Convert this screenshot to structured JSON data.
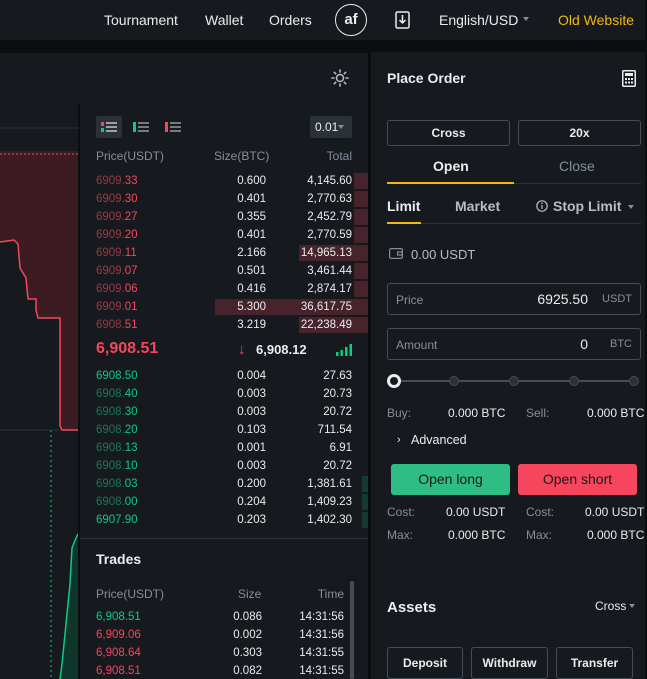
{
  "nav": {
    "links": [
      "Tournament",
      "Wallet",
      "Orders"
    ],
    "avatar": "af",
    "language": "English/USD",
    "old_site": "Old Website"
  },
  "colors": {
    "up": "#0ecb81",
    "down": "#f6465d",
    "accent": "#f0b90b",
    "bg": "#161a1e"
  },
  "orderbook": {
    "precision": "0.01",
    "headers": {
      "price": "Price(USDT)",
      "size": "Size(BTC)",
      "total": "Total"
    },
    "asks": [
      {
        "hi": "6909.",
        "lo": "33",
        "size": "0.600",
        "total": "4,145.60",
        "depth": 0.05
      },
      {
        "hi": "6909.",
        "lo": "30",
        "size": "0.401",
        "total": "2,770.63",
        "depth": 0.05
      },
      {
        "hi": "6909.",
        "lo": "27",
        "size": "0.355",
        "total": "2,452.79",
        "depth": 0.05
      },
      {
        "hi": "6909.",
        "lo": "20",
        "size": "0.401",
        "total": "2,770.59",
        "depth": 0.05
      },
      {
        "hi": "6909.",
        "lo": "11",
        "size": "2.166",
        "total": "14,965.13",
        "depth": 0.24
      },
      {
        "hi": "6909.",
        "lo": "07",
        "size": "0.501",
        "total": "3,461.44",
        "depth": 0.05
      },
      {
        "hi": "6909.",
        "lo": "06",
        "size": "0.416",
        "total": "2,874.17",
        "depth": 0.05
      },
      {
        "hi": "6909.",
        "lo": "01",
        "size": "5.300",
        "total": "36,617.75",
        "depth": 0.53
      },
      {
        "hi": "6908.",
        "lo": "51",
        "size": "3.219",
        "total": "22,238.49",
        "depth": 0.24
      }
    ],
    "mid": {
      "price": "6,908.51",
      "arrow": "↓",
      "mark": "6,908.12"
    },
    "bids": [
      {
        "hi": "6908.",
        "lo": "50",
        "size": "0.004",
        "total": "27.63",
        "hl": true,
        "depth": 0.0
      },
      {
        "hi": "6908.",
        "lo": "40",
        "size": "0.003",
        "total": "20.73",
        "hl": false,
        "depth": 0.0
      },
      {
        "hi": "6908.",
        "lo": "30",
        "size": "0.003",
        "total": "20.72",
        "hl": false,
        "depth": 0.0
      },
      {
        "hi": "6908.",
        "lo": "20",
        "size": "0.103",
        "total": "711.54",
        "hl": false,
        "depth": 0.0
      },
      {
        "hi": "6908.",
        "lo": "13",
        "size": "0.001",
        "total": "6.91",
        "hl": false,
        "depth": 0.0
      },
      {
        "hi": "6908.",
        "lo": "10",
        "size": "0.003",
        "total": "20.72",
        "hl": false,
        "depth": 0.0
      },
      {
        "hi": "6908.",
        "lo": "03",
        "size": "0.200",
        "total": "1,381.61",
        "hl": false,
        "depth": 0.02
      },
      {
        "hi": "6908.",
        "lo": "00",
        "size": "0.204",
        "total": "1,409.23",
        "hl": false,
        "depth": 0.02
      },
      {
        "hi": "6907.",
        "lo": "90",
        "size": "0.203",
        "total": "1,402.30",
        "hl": true,
        "depth": 0.02
      }
    ]
  },
  "trades": {
    "title": "Trades",
    "headers": {
      "price": "Price(USDT)",
      "size": "Size",
      "time": "Time"
    },
    "rows": [
      {
        "price": "6,908.51",
        "side": "up",
        "size": "0.086",
        "time": "14:31:56"
      },
      {
        "price": "6,909.06",
        "side": "down",
        "size": "0.002",
        "time": "14:31:56"
      },
      {
        "price": "6,908.64",
        "side": "down",
        "size": "0.303",
        "time": "14:31:55"
      },
      {
        "price": "6,908.51",
        "side": "down",
        "size": "0.082",
        "time": "14:31:55"
      }
    ]
  },
  "place_order": {
    "title": "Place Order",
    "margin_mode": "Cross",
    "leverage": "20x",
    "tabs": [
      "Open",
      "Close"
    ],
    "types": [
      "Limit",
      "Market",
      "Stop Limit"
    ],
    "available": "0.00 USDT",
    "price": {
      "label": "Price",
      "value": "6925.50",
      "unit": "USDT"
    },
    "amount": {
      "label": "Amount",
      "value": "0",
      "unit": "BTC"
    },
    "slider_level": 0,
    "buy": {
      "label": "Buy:",
      "value": "0.000 BTC"
    },
    "sell": {
      "label": "Sell:",
      "value": "0.000 BTC"
    },
    "advanced": "Advanced",
    "open_long": "Open long",
    "open_short": "Open short",
    "long_cost": {
      "label": "Cost:",
      "value": "0.00 USDT"
    },
    "long_max": {
      "label": "Max:",
      "value": "0.000 BTC"
    },
    "short_cost": {
      "label": "Cost:",
      "value": "0.00 USDT"
    },
    "short_max": {
      "label": "Max:",
      "value": "0.000 BTC"
    }
  },
  "assets": {
    "title": "Assets",
    "mode": "Cross",
    "buttons": [
      "Deposit",
      "Withdraw",
      "Transfer"
    ]
  }
}
